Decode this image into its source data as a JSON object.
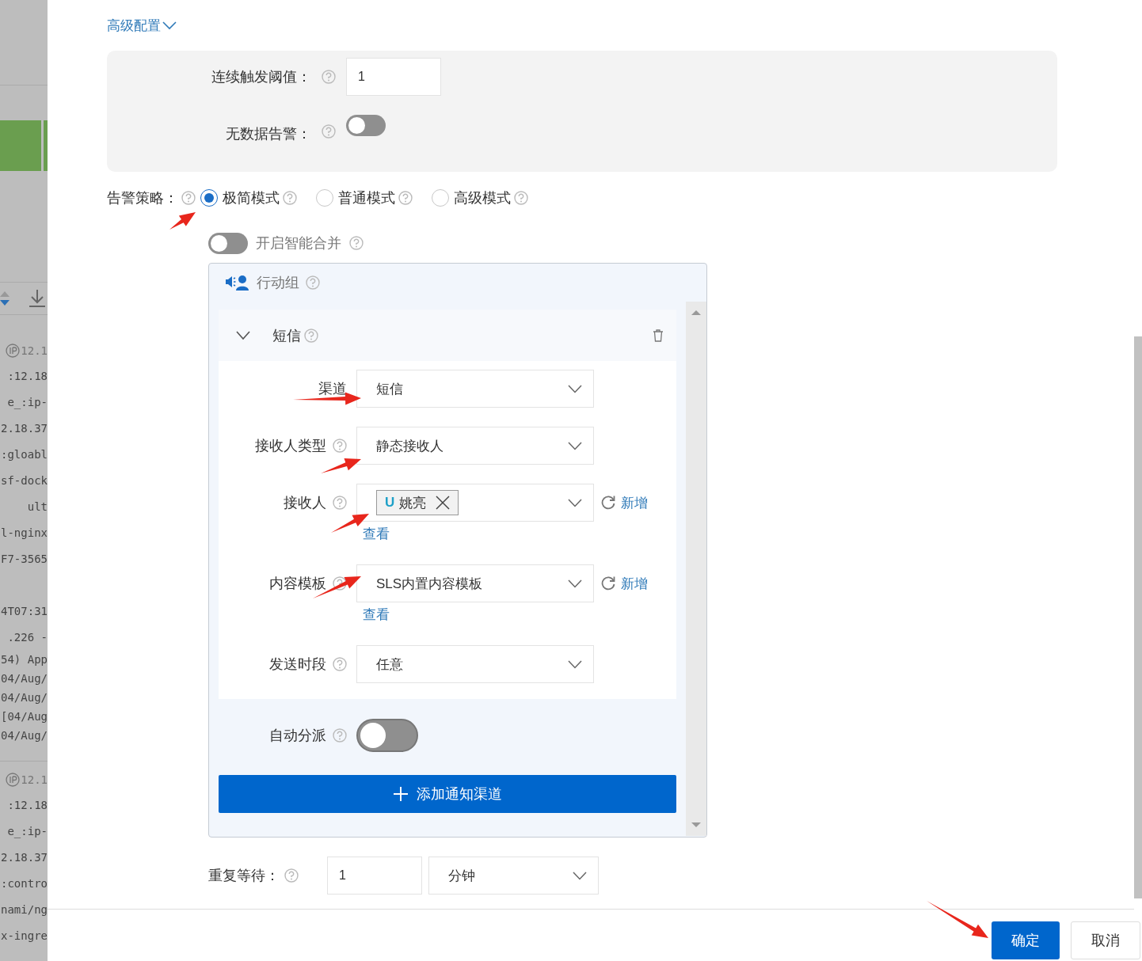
{
  "background_log": {
    "groups": [
      {
        "ip": "12.1",
        "lines": [
          ":12.18",
          "e_:ip-",
          "2.18.37",
          ":gloabl",
          "sf-dock",
          "ult",
          "l-nginx",
          "F7-3565",
          "4T07:31",
          ".226 -",
          "54) App",
          "04/Aug/",
          "04/Aug/",
          "[04/Aug",
          "04/Aug/"
        ]
      },
      {
        "ip": "12.1",
        "lines": [
          ":12.18",
          "e_:ip-",
          "2.18.37",
          ":contro",
          "nami/ng",
          "x-ingre"
        ]
      }
    ]
  },
  "advanced_toggle": "高级配置",
  "advanced": {
    "fields": [
      {
        "kind": "input",
        "label": "连续触发阈值：",
        "value": "1"
      },
      {
        "kind": "switch",
        "label": "无数据告警：",
        "on": false
      }
    ]
  },
  "alert_policy": {
    "label": "告警策略：",
    "options": [
      {
        "label": "极简模式",
        "selected": true
      },
      {
        "label": "普通模式",
        "selected": false
      },
      {
        "label": "高级模式",
        "selected": false
      }
    ]
  },
  "smart_merge": {
    "label": "开启智能合并",
    "on": false
  },
  "action_group": {
    "title": "行动组",
    "channel": {
      "title": "短信",
      "expanded": true,
      "fields": [
        {
          "kind": "select",
          "label": "渠道",
          "help": false,
          "value": "短信"
        },
        {
          "kind": "select",
          "label": "接收人类型",
          "help": true,
          "value": "静态接收人"
        },
        {
          "kind": "tags",
          "label": "接收人",
          "help": true,
          "tags": [
            {
              "prefix": "U",
              "name": "姚亮"
            }
          ],
          "add_link": "新增",
          "view_link": "查看"
        },
        {
          "kind": "select",
          "label": "内容模板",
          "help": true,
          "value": "SLS内置内容模板",
          "add_link": "新增",
          "view_link": "查看"
        },
        {
          "kind": "select",
          "label": "发送时段",
          "help": true,
          "value": "任意"
        }
      ]
    },
    "auto_assign": {
      "label": "自动分派",
      "on": false
    },
    "add_button": "添加通知渠道"
  },
  "repeat_wait": {
    "label": "重复等待：",
    "value": "1",
    "unit": "分钟"
  },
  "footer": {
    "buttons": [
      {
        "kind": "primary",
        "label": "确定"
      },
      {
        "kind": "default",
        "label": "取消"
      }
    ]
  }
}
